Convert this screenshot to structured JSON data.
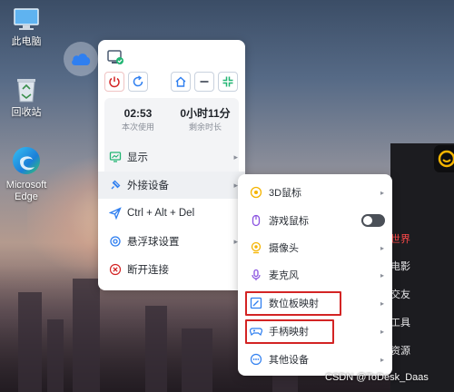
{
  "desktop": {
    "icons": [
      {
        "label": "此电脑",
        "icon": "computer-icon"
      },
      {
        "label": "回收站",
        "icon": "recycle-bin-icon"
      },
      {
        "label": "Microsoft Edge",
        "icon": "edge-icon"
      }
    ]
  },
  "panel": {
    "toolbar": [
      "logo-icon",
      "power-icon",
      "refresh-icon",
      "home-icon",
      "minimize-icon",
      "collapse-icon"
    ],
    "stats": {
      "used_value": "02:53",
      "used_label": "本次使用",
      "remaining_value": "0小时11分",
      "remaining_label": "剩余时长"
    },
    "menu": [
      {
        "label": "显示",
        "icon": "display-icon",
        "has_submenu": true
      },
      {
        "label": "外接设备",
        "icon": "plug-icon",
        "has_submenu": true
      },
      {
        "label": "Ctrl + Alt + Del",
        "icon": "send-icon",
        "has_submenu": false
      },
      {
        "label": "悬浮球设置",
        "icon": "gear-icon",
        "has_submenu": true
      },
      {
        "label": "断开连接",
        "icon": "disconnect-icon",
        "has_submenu": false
      }
    ]
  },
  "submenu": {
    "items": [
      {
        "label": "3D鼠标",
        "icon": "3d-mouse-icon"
      },
      {
        "label": "游戏鼠标",
        "icon": "game-mouse-icon",
        "toggle": false
      },
      {
        "label": "摄像头",
        "icon": "camera-icon"
      },
      {
        "label": "麦克风",
        "icon": "microphone-icon"
      },
      {
        "label": "数位板映射",
        "icon": "tablet-icon",
        "highlighted": true
      },
      {
        "label": "手柄映射",
        "icon": "gamepad-icon",
        "highlighted": true
      },
      {
        "label": "其他设备",
        "icon": "more-icon"
      }
    ]
  },
  "background_app": {
    "items": [
      "世界",
      "电影",
      "交友",
      "工具",
      "资源"
    ]
  },
  "watermark": "CSDN @ToDesk_Daas",
  "colors": {
    "accent_blue": "#2f7ff0",
    "danger_red": "#d32424",
    "green": "#22b573"
  }
}
